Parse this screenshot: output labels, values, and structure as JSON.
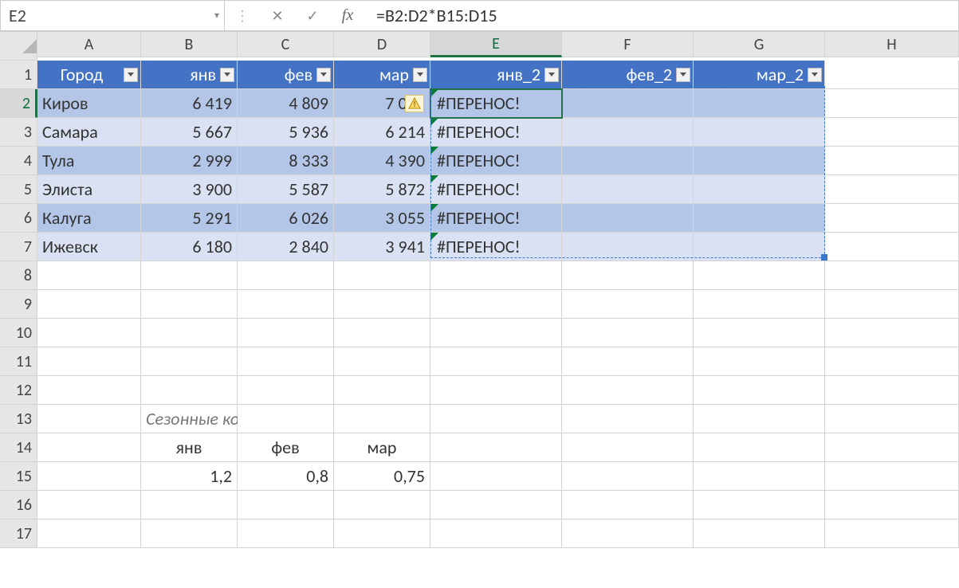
{
  "formula_bar": {
    "name_box": "E2",
    "fx_label": "fx",
    "formula": "=B2:D2*B15:D15"
  },
  "columns": [
    "A",
    "B",
    "C",
    "D",
    "E",
    "F",
    "G",
    "H"
  ],
  "active_column_index": 4,
  "active_row": 2,
  "rows_shown": 17,
  "table": {
    "headers": [
      "Город",
      "янв",
      "фев",
      "мар",
      "янв_2",
      "фев_2",
      "мар_2"
    ],
    "rows": [
      {
        "city": "Киров",
        "jan": "6 419",
        "feb": "4 809",
        "mar": "7 045",
        "e": "#ПЕРЕНОС!",
        "f": "",
        "g": ""
      },
      {
        "city": "Самара",
        "jan": "5 667",
        "feb": "5 936",
        "mar": "6 214",
        "e": "#ПЕРЕНОС!",
        "f": "",
        "g": ""
      },
      {
        "city": "Тула",
        "jan": "2 999",
        "feb": "8 333",
        "mar": "4 390",
        "e": "#ПЕРЕНОС!",
        "f": "",
        "g": ""
      },
      {
        "city": "Элиста",
        "jan": "3 900",
        "feb": "5 587",
        "mar": "5 872",
        "e": "#ПЕРЕНОС!",
        "f": "",
        "g": ""
      },
      {
        "city": "Калуга",
        "jan": "5 291",
        "feb": "6 026",
        "mar": "3 055",
        "e": "#ПЕРЕНОС!",
        "f": "",
        "g": ""
      },
      {
        "city": "Ижевск",
        "jan": "6 180",
        "feb": "2 840",
        "mar": "3 941",
        "e": "#ПЕРЕНОС!",
        "f": "",
        "g": ""
      }
    ]
  },
  "seasonal": {
    "title": "Сезонные коэффициенты",
    "labels": [
      "янв",
      "фев",
      "мар"
    ],
    "values": [
      "1,2",
      "0,8",
      "0,75"
    ]
  },
  "chart_data": {
    "type": "table",
    "title": "Сезонные коэффициенты",
    "categories": [
      "янв",
      "фев",
      "мар"
    ],
    "series": [
      {
        "name": "Киров",
        "values": [
          6419,
          4809,
          7045
        ]
      },
      {
        "name": "Самара",
        "values": [
          5667,
          5936,
          6214
        ]
      },
      {
        "name": "Тула",
        "values": [
          2999,
          8333,
          4390
        ]
      },
      {
        "name": "Элиста",
        "values": [
          3900,
          5587,
          5872
        ]
      },
      {
        "name": "Калуга",
        "values": [
          5291,
          6026,
          3055
        ]
      },
      {
        "name": "Ижевск",
        "values": [
          6180,
          2840,
          3941
        ]
      }
    ],
    "coefficients": [
      1.2,
      0.8,
      0.75
    ]
  }
}
